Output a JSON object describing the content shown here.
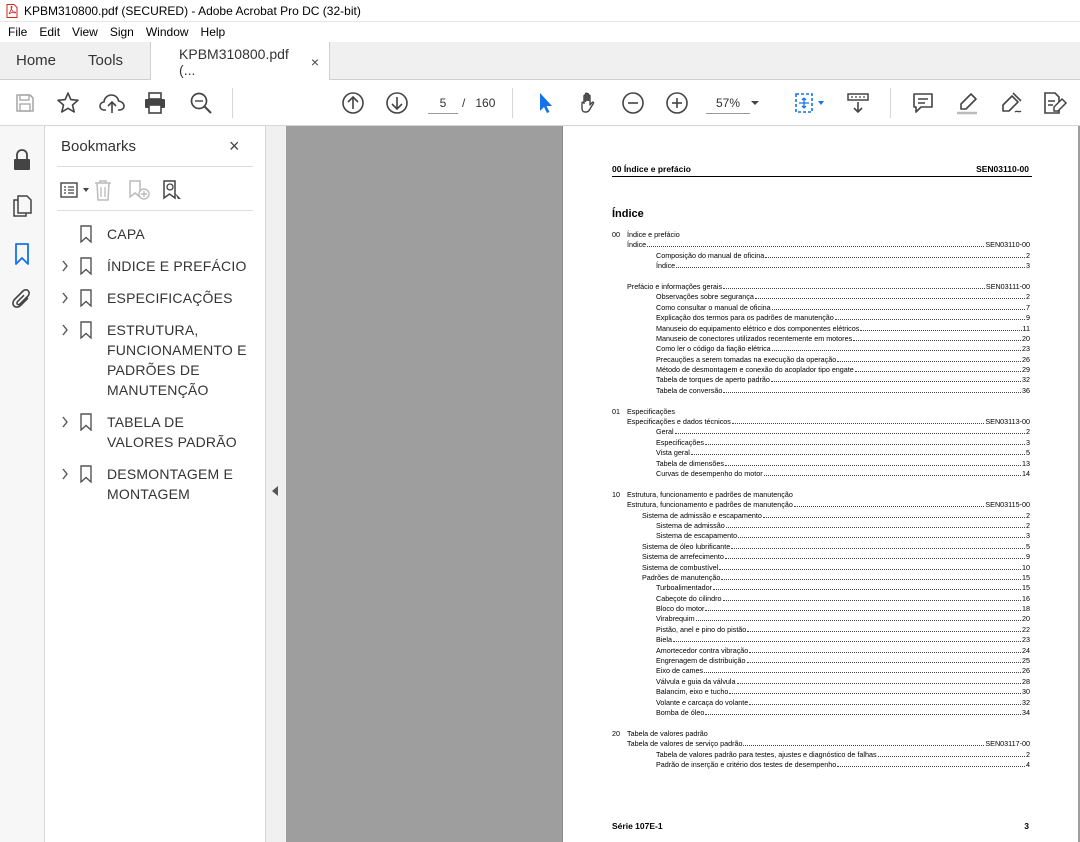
{
  "window": {
    "title": "KPBM310800.pdf (SECURED) - Adobe Acrobat Pro DC (32-bit)"
  },
  "menu": [
    "File",
    "Edit",
    "View",
    "Sign",
    "Window",
    "Help"
  ],
  "tabs": {
    "home": "Home",
    "tools": "Tools",
    "doc": "KPBM310800.pdf (...",
    "close": "×"
  },
  "toolbar": {
    "current_page": "5",
    "page_sep": "/",
    "total_pages": "160",
    "zoom": "57%"
  },
  "bookmarks": {
    "header": "Bookmarks",
    "close": "×",
    "items": [
      {
        "label": "CAPA",
        "expandable": false
      },
      {
        "label": "ÍNDICE E PREFÁCIO",
        "expandable": true
      },
      {
        "label": "ESPECIFICAÇÕES",
        "expandable": true
      },
      {
        "label": "ESTRUTURA, FUNCIONAMENTO E PADRÕES DE MANUTENÇÃO",
        "expandable": true
      },
      {
        "label": "TABELA DE VALORES PADRÃO",
        "expandable": true
      },
      {
        "label": "DESMONTAGEM E MONTAGEM",
        "expandable": true
      }
    ]
  },
  "page": {
    "header_left": "00 Índice e prefácio",
    "header_right": "SEN03110-00",
    "title": "Índice",
    "footer_left": "Série 107E-1",
    "footer_right": "3",
    "toc": [
      {
        "num": "00",
        "text": "Índice e prefácio",
        "indent": 0,
        "page": ""
      },
      {
        "num": "",
        "text": "Índice",
        "indent": 1,
        "page": "SEN03110-00"
      },
      {
        "num": "",
        "text": "Composição do manual de oficina",
        "indent": 3,
        "page": "2"
      },
      {
        "num": "",
        "text": "Índice",
        "indent": 3,
        "page": "3"
      },
      {
        "gap": true
      },
      {
        "num": "",
        "text": "Prefácio e informações gerais",
        "indent": 1,
        "page": "SEN03111-00"
      },
      {
        "num": "",
        "text": "Observações sobre segurança",
        "indent": 3,
        "page": "2"
      },
      {
        "num": "",
        "text": "Como consultar o manual de oficina",
        "indent": 3,
        "page": "7"
      },
      {
        "num": "",
        "text": "Explicação dos termos para os padrões de manutenção",
        "indent": 3,
        "page": "9"
      },
      {
        "num": "",
        "text": "Manuseio do equipamento elétrico e dos componentes elétricos",
        "indent": 3,
        "page": "11"
      },
      {
        "num": "",
        "text": "Manuseio de conectores utilizados recentemente em motores",
        "indent": 3,
        "page": "20"
      },
      {
        "num": "",
        "text": "Como ler o código da fiação elétrica",
        "indent": 3,
        "page": "23"
      },
      {
        "num": "",
        "text": "Precauções a serem tomadas na execução da operação",
        "indent": 3,
        "page": "26"
      },
      {
        "num": "",
        "text": "Método de desmontagem e conexão do acoplador tipo engate",
        "indent": 3,
        "page": "29"
      },
      {
        "num": "",
        "text": "Tabela de torques de aperto padrão",
        "indent": 3,
        "page": "32"
      },
      {
        "num": "",
        "text": "Tabela de conversão",
        "indent": 3,
        "page": "36"
      },
      {
        "gap": true
      },
      {
        "num": "01",
        "text": "Especificações",
        "indent": 0,
        "page": ""
      },
      {
        "num": "",
        "text": "Especificações e dados técnicos",
        "indent": 1,
        "page": "SEN03113-00"
      },
      {
        "num": "",
        "text": "Geral",
        "indent": 3,
        "page": "2"
      },
      {
        "num": "",
        "text": "Especificações",
        "indent": 3,
        "page": "3"
      },
      {
        "num": "",
        "text": "Vista geral",
        "indent": 3,
        "page": "5"
      },
      {
        "num": "",
        "text": "Tabela de dimensões",
        "indent": 3,
        "page": "13"
      },
      {
        "num": "",
        "text": "Curvas de desempenho do motor",
        "indent": 3,
        "page": "14"
      },
      {
        "gap": true
      },
      {
        "num": "10",
        "text": "Estrutura, funcionamento e padrões de manutenção",
        "indent": 0,
        "page": ""
      },
      {
        "num": "",
        "text": "Estrutura, funcionamento e padrões de manutenção",
        "indent": 1,
        "page": "SEN03115-00"
      },
      {
        "num": "",
        "text": "Sistema de admissão e escapamento",
        "indent": 2,
        "page": "2"
      },
      {
        "num": "",
        "text": "Sistema de admissão",
        "indent": 3,
        "page": "2"
      },
      {
        "num": "",
        "text": "Sistema de escapamento",
        "indent": 3,
        "page": "3"
      },
      {
        "num": "",
        "text": "Sistema de óleo lubrificante",
        "indent": 2,
        "page": "5"
      },
      {
        "num": "",
        "text": "Sistema de arrefecimento",
        "indent": 2,
        "page": "9"
      },
      {
        "num": "",
        "text": "Sistema de combustível",
        "indent": 2,
        "page": "10"
      },
      {
        "num": "",
        "text": "Padrões de manutenção",
        "indent": 2,
        "page": "15"
      },
      {
        "num": "",
        "text": "Turboalimentador",
        "indent": 3,
        "page": "15"
      },
      {
        "num": "",
        "text": "Cabeçote do cilindro",
        "indent": 3,
        "page": "16"
      },
      {
        "num": "",
        "text": "Bloco do motor",
        "indent": 3,
        "page": "18"
      },
      {
        "num": "",
        "text": "Virabrequim",
        "indent": 3,
        "page": "20"
      },
      {
        "num": "",
        "text": "Pistão, anel e pino do pistão",
        "indent": 3,
        "page": "22"
      },
      {
        "num": "",
        "text": "Biela",
        "indent": 3,
        "page": "23"
      },
      {
        "num": "",
        "text": "Amortecedor contra vibração",
        "indent": 3,
        "page": "24"
      },
      {
        "num": "",
        "text": "Engrenagem de distribuição",
        "indent": 3,
        "page": "25"
      },
      {
        "num": "",
        "text": "Eixo de cames",
        "indent": 3,
        "page": "26"
      },
      {
        "num": "",
        "text": "Válvula e guia da válvula",
        "indent": 3,
        "page": "28"
      },
      {
        "num": "",
        "text": "Balancim, eixo e tucho",
        "indent": 3,
        "page": "30"
      },
      {
        "num": "",
        "text": "Volante e carcaça do volante",
        "indent": 3,
        "page": "32"
      },
      {
        "num": "",
        "text": "Bomba de óleo",
        "indent": 3,
        "page": "34"
      },
      {
        "gap": true
      },
      {
        "num": "20",
        "text": "Tabela de valores padrão",
        "indent": 0,
        "page": ""
      },
      {
        "num": "",
        "text": "Tabela de valores de serviço padrão",
        "indent": 1,
        "page": "SEN03117-00"
      },
      {
        "num": "",
        "text": "Tabela de valores padrão para testes, ajustes e diagnóstico de falhas",
        "indent": 3,
        "page": "2"
      },
      {
        "num": "",
        "text": "Padrão de inserção e critério dos testes de desempenho",
        "indent": 3,
        "page": "4"
      }
    ]
  },
  "colors": {
    "accent": "#1473e6",
    "viewer_bg": "#9e9e9e",
    "pdf_red": "#d9241c"
  },
  "icons": {
    "toolbar": [
      "save-icon",
      "star-icon",
      "cloud-upload-icon",
      "print-icon",
      "search-icon",
      "page-up-icon",
      "page-down-icon",
      "select-arrow-icon",
      "hand-icon",
      "zoom-out-icon",
      "zoom-in-icon",
      "fit-page-icon",
      "scroll-mode-icon",
      "comment-icon",
      "highlight-icon",
      "sign-icon",
      "edit-pdf-icon"
    ]
  }
}
